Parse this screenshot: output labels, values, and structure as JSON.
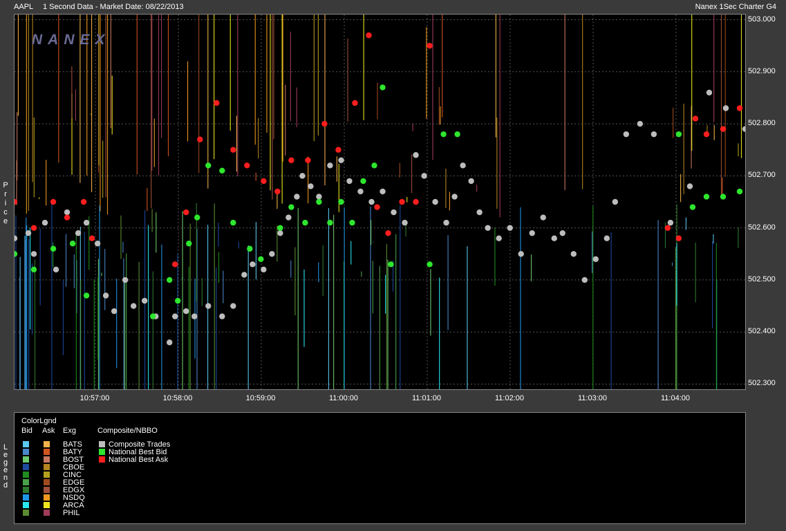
{
  "header": {
    "symbol": "AAPL",
    "description": "1 Second Data - Market Date: 08/22/2013",
    "right_title": "Nanex 1Sec Charter G4",
    "watermark": "NANEX"
  },
  "axis": {
    "price_label": "Price",
    "y_ticks": [
      "503.000",
      "502.900",
      "502.800",
      "502.700",
      "502.600",
      "502.500",
      "502.400",
      "502.300"
    ],
    "x_ticks": [
      "10:57:00",
      "10:58:00",
      "10:59:00",
      "11:00:00",
      "11:01:00",
      "11:02:00",
      "11:03:00",
      "11:04:00"
    ]
  },
  "legend": {
    "side_label": "Legend",
    "title": "ColorLgnd",
    "col_bid": "Bid",
    "col_ask": "Ask",
    "col_exg": "Exg",
    "col_composite": "Composite/NBBO",
    "exchanges": [
      {
        "name": "BATS",
        "bid": "#5bc8f0",
        "ask": "#f2b24a"
      },
      {
        "name": "BATY",
        "bid": "#4a86c8",
        "ask": "#d2541e"
      },
      {
        "name": "BOST",
        "bid": "#6cc86c",
        "ask": "#c87860"
      },
      {
        "name": "CBOE",
        "bid": "#1e4aa0",
        "ask": "#b4841e"
      },
      {
        "name": "CINC",
        "bid": "#1e8c1e",
        "ask": "#b4a01e"
      },
      {
        "name": "EDGE",
        "bid": "#4aa04a",
        "ask": "#a04a1e"
      },
      {
        "name": "EDGX",
        "bid": "#2e7a2e",
        "ask": "#a0503c"
      },
      {
        "name": "NSDQ",
        "bid": "#1e96e6",
        "ask": "#f09a1e"
      },
      {
        "name": "ARCA",
        "bid": "#28e6f0",
        "ask": "#f0e61e"
      },
      {
        "name": "PHIL",
        "bid": "#5a8c32",
        "ask": "#a03c5a"
      }
    ],
    "composite": [
      {
        "name": "Composite Trades",
        "color": "#bdbdbd"
      },
      {
        "name": "National Best Bid",
        "color": "#2ee62e"
      },
      {
        "name": "National Best Ask",
        "color": "#ff1e1e"
      }
    ]
  },
  "chart_data": {
    "type": "scatter",
    "title": "1 Second Data - Market Date: 08/22/2013",
    "ylabel": "Price",
    "ylim": [
      502.29,
      503.01
    ],
    "xlim_seconds_from_1056": [
      0,
      528
    ],
    "series": [
      {
        "name": "Composite Trades",
        "color": "#bdbdbd",
        "points": [
          [
            0,
            502.58
          ],
          [
            10,
            502.59
          ],
          [
            14,
            502.55
          ],
          [
            22,
            502.61
          ],
          [
            30,
            502.52
          ],
          [
            38,
            502.63
          ],
          [
            46,
            502.59
          ],
          [
            52,
            502.61
          ],
          [
            60,
            502.57
          ],
          [
            66,
            502.47
          ],
          [
            72,
            502.44
          ],
          [
            80,
            502.5
          ],
          [
            86,
            502.45
          ],
          [
            94,
            502.46
          ],
          [
            102,
            502.43
          ],
          [
            112,
            502.38
          ],
          [
            116,
            502.43
          ],
          [
            124,
            502.44
          ],
          [
            130,
            502.43
          ],
          [
            140,
            502.45
          ],
          [
            150,
            502.43
          ],
          [
            158,
            502.45
          ],
          [
            166,
            502.51
          ],
          [
            172,
            502.53
          ],
          [
            180,
            502.52
          ],
          [
            186,
            502.55
          ],
          [
            192,
            502.59
          ],
          [
            198,
            502.62
          ],
          [
            204,
            502.66
          ],
          [
            208,
            502.7
          ],
          [
            214,
            502.68
          ],
          [
            220,
            502.66
          ],
          [
            228,
            502.72
          ],
          [
            236,
            502.73
          ],
          [
            242,
            502.69
          ],
          [
            250,
            502.67
          ],
          [
            258,
            502.65
          ],
          [
            266,
            502.67
          ],
          [
            274,
            502.63
          ],
          [
            282,
            502.61
          ],
          [
            290,
            502.74
          ],
          [
            296,
            502.7
          ],
          [
            304,
            502.65
          ],
          [
            312,
            502.61
          ],
          [
            318,
            502.66
          ],
          [
            324,
            502.72
          ],
          [
            330,
            502.69
          ],
          [
            336,
            502.63
          ],
          [
            342,
            502.6
          ],
          [
            350,
            502.58
          ],
          [
            358,
            502.6
          ],
          [
            366,
            502.55
          ],
          [
            374,
            502.59
          ],
          [
            382,
            502.62
          ],
          [
            390,
            502.58
          ],
          [
            396,
            502.59
          ],
          [
            404,
            502.55
          ],
          [
            412,
            502.5
          ],
          [
            420,
            502.54
          ],
          [
            428,
            502.58
          ],
          [
            434,
            502.65
          ],
          [
            442,
            502.78
          ],
          [
            452,
            502.8
          ],
          [
            462,
            502.78
          ],
          [
            474,
            502.61
          ],
          [
            488,
            502.68
          ],
          [
            502,
            502.86
          ],
          [
            514,
            502.83
          ],
          [
            528,
            502.79
          ]
        ]
      },
      {
        "name": "National Best Bid",
        "color": "#2ee62e",
        "points": [
          [
            0,
            502.55
          ],
          [
            14,
            502.52
          ],
          [
            28,
            502.56
          ],
          [
            42,
            502.57
          ],
          [
            52,
            502.47
          ],
          [
            100,
            502.43
          ],
          [
            112,
            502.5
          ],
          [
            118,
            502.46
          ],
          [
            126,
            502.57
          ],
          [
            132,
            502.62
          ],
          [
            140,
            502.72
          ],
          [
            150,
            502.71
          ],
          [
            158,
            502.61
          ],
          [
            170,
            502.56
          ],
          [
            178,
            502.54
          ],
          [
            192,
            502.6
          ],
          [
            200,
            502.64
          ],
          [
            210,
            502.61
          ],
          [
            220,
            502.65
          ],
          [
            228,
            502.61
          ],
          [
            236,
            502.65
          ],
          [
            244,
            502.61
          ],
          [
            252,
            502.69
          ],
          [
            260,
            502.72
          ],
          [
            266,
            502.87
          ],
          [
            272,
            502.53
          ],
          [
            300,
            502.53
          ],
          [
            310,
            502.78
          ],
          [
            320,
            502.78
          ],
          [
            480,
            502.78
          ],
          [
            490,
            502.64
          ],
          [
            500,
            502.66
          ],
          [
            512,
            502.66
          ],
          [
            524,
            502.67
          ]
        ]
      },
      {
        "name": "National Best Ask",
        "color": "#ff1e1e",
        "points": [
          [
            0,
            502.65
          ],
          [
            14,
            502.6
          ],
          [
            28,
            502.65
          ],
          [
            38,
            502.62
          ],
          [
            50,
            502.65
          ],
          [
            56,
            502.58
          ],
          [
            116,
            502.53
          ],
          [
            124,
            502.63
          ],
          [
            134,
            502.77
          ],
          [
            146,
            502.84
          ],
          [
            158,
            502.75
          ],
          [
            168,
            502.72
          ],
          [
            180,
            502.69
          ],
          [
            190,
            502.67
          ],
          [
            200,
            502.73
          ],
          [
            212,
            502.73
          ],
          [
            224,
            502.8
          ],
          [
            234,
            502.75
          ],
          [
            246,
            502.84
          ],
          [
            256,
            502.97
          ],
          [
            262,
            502.64
          ],
          [
            270,
            502.59
          ],
          [
            280,
            502.65
          ],
          [
            290,
            502.65
          ],
          [
            300,
            502.95
          ],
          [
            472,
            502.6
          ],
          [
            480,
            502.58
          ],
          [
            492,
            502.81
          ],
          [
            500,
            502.78
          ],
          [
            512,
            502.79
          ],
          [
            524,
            502.83
          ]
        ]
      }
    ]
  }
}
